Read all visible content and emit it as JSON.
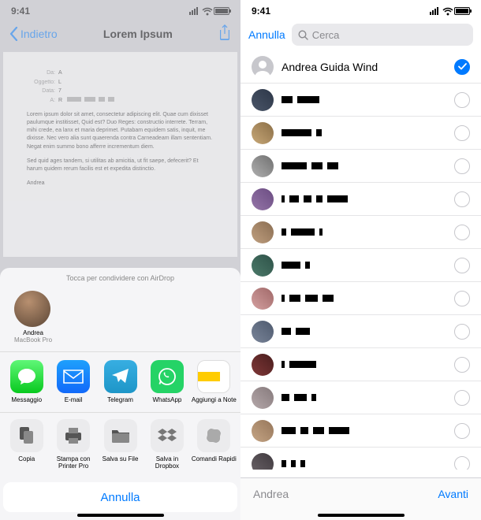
{
  "status_time": "9:41",
  "left": {
    "back_label": "Indietro",
    "title": "Lorem Ipsum",
    "email_meta": {
      "from_lbl": "Da:",
      "from_val": "A",
      "subj_lbl": "Oggetto:",
      "subj_val": "L",
      "date_lbl": "Data:",
      "date_val": "7",
      "to_lbl": "A:",
      "to_val": "R"
    },
    "body_p1": "Lorem ipsum dolor sit amet, consectetur adipiscing elit. Quae cum dixisset paulumque institisset, Quid est? Duo Reges: constructio interrete. Terram, mihi crede, ea lanx et maria deprimet. Putabam equidem satis, inquit, me dixisse. Nec vero alia sunt quaerenda contra Carneadeam illam sententiam. Negat enim summo bono afferre incrementum diem.",
    "body_p2": "Sed quid ages tandem, si utilitas ab amicitia, ut fit saepe, defecerit? Et harum quidem rerum facilis est et expedita distinctio.",
    "body_sig": "Andrea"
  },
  "sheet": {
    "airdrop_hint": "Tocca per condividere con AirDrop",
    "airdrop_name": "Andrea",
    "airdrop_device": "MacBook Pro",
    "apps": [
      {
        "label": "Messaggio"
      },
      {
        "label": "E-mail"
      },
      {
        "label": "Telegram"
      },
      {
        "label": "WhatsApp"
      },
      {
        "label": "Aggiungi a Note"
      }
    ],
    "actions": [
      {
        "label": "Copia"
      },
      {
        "label": "Stampa con Printer Pro"
      },
      {
        "label": "Salva su File"
      },
      {
        "label": "Salva in Dropbox"
      },
      {
        "label": "Comandi Rapidi"
      }
    ],
    "cancel_label": "Annulla"
  },
  "right": {
    "cancel_label": "Annulla",
    "search_placeholder": "Cerca",
    "contacts": [
      {
        "name": "Andrea Guida Wind",
        "selected": true
      }
    ],
    "footer_selected": "Andrea",
    "footer_next": "Avanti"
  }
}
